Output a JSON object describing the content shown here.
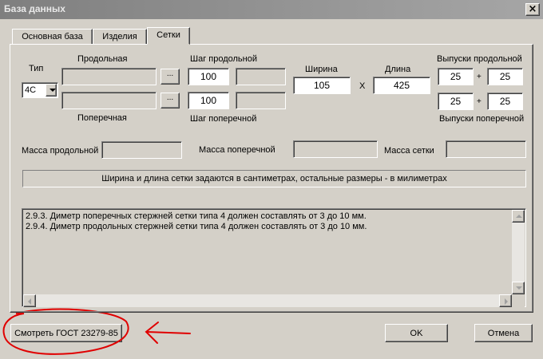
{
  "window": {
    "title": "База данных",
    "close_icon": "close-icon"
  },
  "tabs": [
    {
      "label": "Основная база"
    },
    {
      "label": "Изделия"
    },
    {
      "label": "Сетки",
      "active": true
    }
  ],
  "form": {
    "type_label": "Тип",
    "type_value": "4С",
    "longitudinal_label": "Продольная",
    "transverse_label": "Поперечная",
    "browse_label": "...",
    "step_long_label": "Шаг продольной",
    "step_long_value": "100",
    "step_trans_label": "Шаг поперечной",
    "step_trans_value": "100",
    "width_label": "Ширина",
    "width_value": "105",
    "times_sign": "X",
    "length_label": "Длина",
    "length_value": "425",
    "outlets_long_label": "Выпуски продольной",
    "outlets_long_a": "25",
    "outlets_long_b": "25",
    "outlets_trans_label": "Выпуски поперечной",
    "outlets_trans_a": "25",
    "outlets_trans_b": "25",
    "plus_sign": "+",
    "mass_long_label": "Масса продольной",
    "mass_trans_label": "Масса поперечной",
    "mass_mesh_label": "Масса сетки"
  },
  "info_text": "Ширина и длина сетки задаются в сантиметрах, остальные размеры - в милиметрах",
  "memo_lines": [
    "2.9.3. Диметр поперечных стержней сетки типа 4 должен составлять от 3 до 10 мм.",
    "2.9.4. Диметр продольных стержней сетки типа 4 должен составлять от 3 до 10 мм."
  ],
  "buttons": {
    "gost": "Смотреть ГОСТ 23279-85",
    "ok": "OK",
    "cancel": "Отмена"
  },
  "annotation_color": "#e00000"
}
